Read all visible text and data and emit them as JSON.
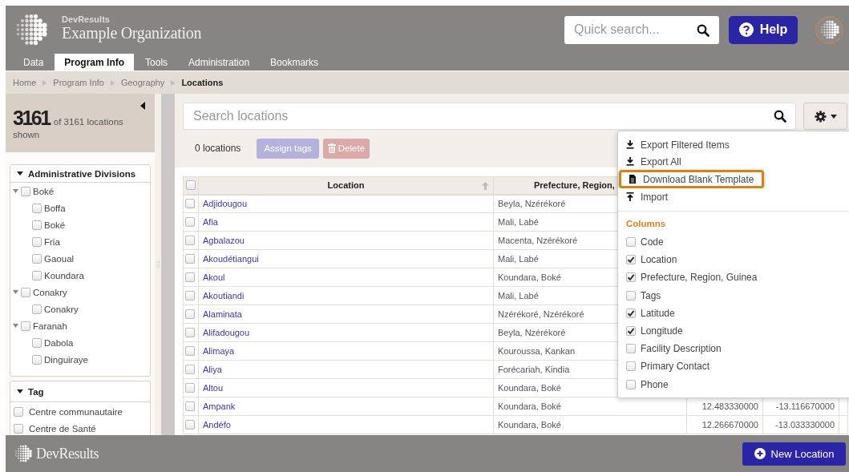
{
  "header": {
    "org_label": "DevResults",
    "org_name": "Example Organization",
    "quick_search": {
      "placeholder": "Quick search..."
    },
    "help_button": "Help"
  },
  "tabs": [
    {
      "label": "Data",
      "selected": false
    },
    {
      "label": "Program Info",
      "selected": true
    },
    {
      "label": "Tools",
      "selected": false
    },
    {
      "label": "Administration",
      "selected": false
    },
    {
      "label": "Bookmarks",
      "selected": false
    }
  ],
  "breadcrumb": [
    {
      "label": "Home",
      "current": false
    },
    {
      "label": "Program Info",
      "current": false
    },
    {
      "label": "Geography",
      "current": false
    },
    {
      "label": "Locations",
      "current": true
    }
  ],
  "summary": {
    "count": "3161",
    "text": "of 3161 locations shown"
  },
  "filters": [
    {
      "title": "Administrative Divisions",
      "expanded": true,
      "items": [
        {
          "label": "Boké",
          "checked": false,
          "expanded": true,
          "children": [
            {
              "label": "Boffa",
              "checked": false
            },
            {
              "label": "Boké",
              "checked": false
            },
            {
              "label": "Fria",
              "checked": false
            },
            {
              "label": "Gaoual",
              "checked": false
            },
            {
              "label": "Koundara",
              "checked": false
            }
          ]
        },
        {
          "label": "Conakry",
          "checked": false,
          "expanded": true,
          "children": [
            {
              "label": "Conakry",
              "checked": false
            }
          ]
        },
        {
          "label": "Faranah",
          "checked": false,
          "expanded": true,
          "children": [
            {
              "label": "Dabola",
              "checked": false
            },
            {
              "label": "Dinguiraye",
              "checked": false
            }
          ]
        }
      ]
    },
    {
      "title": "Tag",
      "expanded": true,
      "items": [
        {
          "label": "Centre communautaire",
          "checked": false
        },
        {
          "label": "Centre de Santé",
          "checked": false
        }
      ]
    }
  ],
  "search": {
    "placeholder": "Search locations"
  },
  "selection_count": "0 locations",
  "actions": [
    {
      "label": "Assign tags",
      "kind": "tags",
      "disabled": true
    },
    {
      "label": "Delete",
      "kind": "delete",
      "disabled": true
    }
  ],
  "table": {
    "all_selected": false,
    "columns": [
      {
        "label": "Location",
        "sorted": true
      },
      {
        "label": "Prefecture, Region,"
      }
    ],
    "rows": [
      {
        "location": "Adjidougou",
        "prefecture": "Beyla, Nzérékoré",
        "selected": false
      },
      {
        "location": "Afia",
        "prefecture": "Mali, Labé",
        "selected": false
      },
      {
        "location": "Agbalazou",
        "prefecture": "Macenta, Nzérékoré",
        "selected": false
      },
      {
        "location": "Akoudétiangui",
        "prefecture": "Mali, Labé",
        "selected": false
      },
      {
        "location": "Akoul",
        "prefecture": "Koundara, Boké",
        "selected": false
      },
      {
        "location": "Akoutiandi",
        "prefecture": "Mali, Labé",
        "selected": false
      },
      {
        "location": "Alaminata",
        "prefecture": "Nzérékoré, Nzérékoré",
        "selected": false
      },
      {
        "location": "Alifadougou",
        "prefecture": "Beyla, Nzérékoré",
        "selected": false
      },
      {
        "location": "Alimaya",
        "prefecture": "Kouroussa, Kankan",
        "selected": false
      },
      {
        "location": "Aliya",
        "prefecture": "Forécariah, Kindia",
        "selected": false
      },
      {
        "location": "Altou",
        "prefecture": "Koundara, Boké",
        "selected": false
      },
      {
        "location": "Ampank",
        "prefecture": "Koundara, Boké",
        "latitude": "12.483330000",
        "longitude": "-13.116670000",
        "selected": false
      },
      {
        "location": "Andéfo",
        "prefecture": "Koundara, Boké",
        "latitude": "12.266670000",
        "longitude": "-13.033330000",
        "selected": false
      }
    ]
  },
  "menu": {
    "actions": [
      {
        "label": "Export Filtered Items",
        "kind": "download",
        "highlighted": false
      },
      {
        "label": "Export All",
        "kind": "download",
        "highlighted": false
      },
      {
        "label": "Download Blank Template",
        "kind": "file",
        "highlighted": true
      },
      {
        "label": "Import",
        "kind": "upload",
        "highlighted": false
      }
    ],
    "columns_title": "Columns",
    "columns": [
      {
        "label": "Code",
        "checked": false
      },
      {
        "label": "Location",
        "checked": true
      },
      {
        "label": "Prefecture, Region, Guinea",
        "checked": true
      },
      {
        "label": "Tags",
        "checked": false
      },
      {
        "label": "Latitude",
        "checked": true
      },
      {
        "label": "Longitude",
        "checked": true
      },
      {
        "label": "Facility Description",
        "checked": false
      },
      {
        "label": "Primary Contact",
        "checked": false
      },
      {
        "label": "Phone",
        "checked": false
      }
    ]
  },
  "footer": {
    "brand": "DevResults",
    "new_button": "New Location"
  }
}
